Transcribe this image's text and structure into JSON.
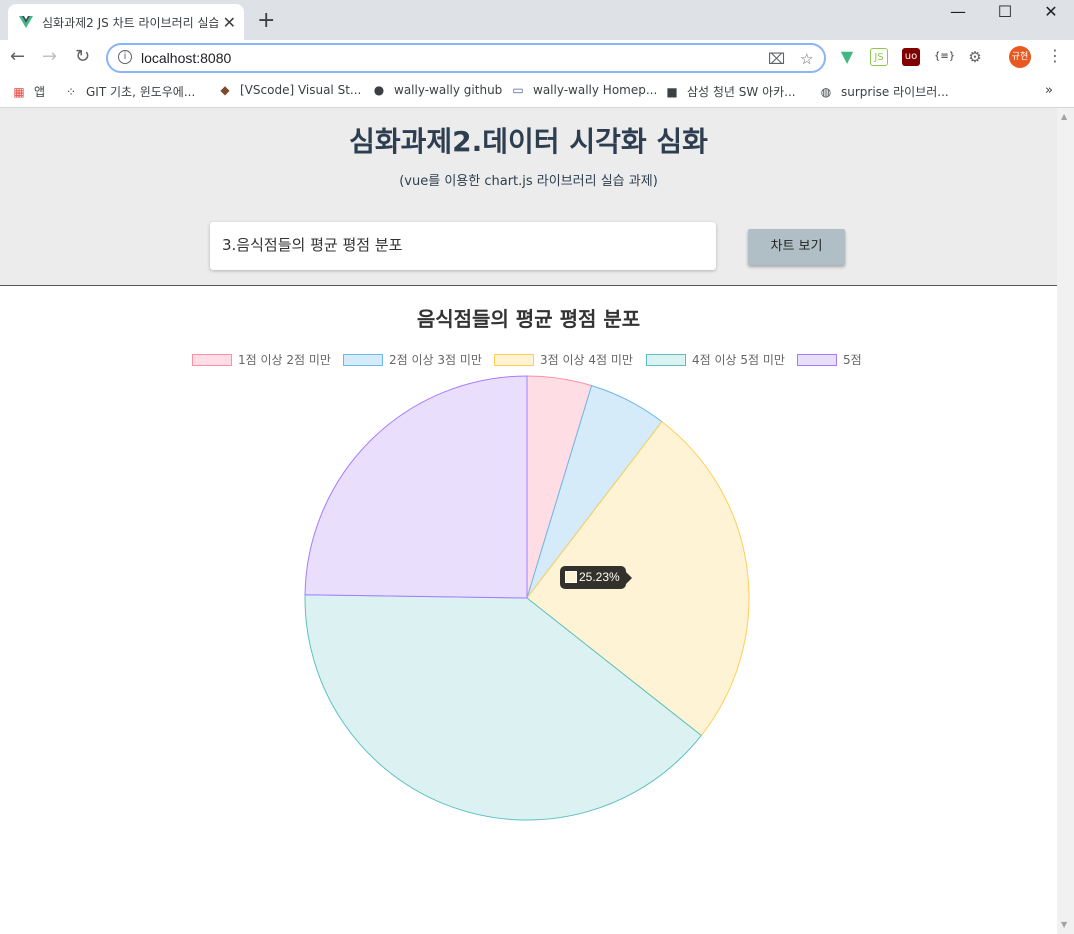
{
  "browser": {
    "tab_title": "심화과제2 JS 차트 라이브러리 실습",
    "url": "localhost:8080",
    "bookmarks": [
      "앱",
      "GIT 기초, 윈도우에...",
      "[VScode] Visual St...",
      "wally-wally github",
      "wally-wally Homep...",
      "삼성 청년 SW 아카...",
      "surprise 라이브러..."
    ],
    "profile_label": "규현",
    "icons": {
      "back": "back-arrow-icon",
      "forward": "forward-arrow-icon",
      "reload": "reload-icon",
      "apps": "apps-grid-icon",
      "vue_devtools": "vue-devtools-icon",
      "node": "nodejs-icon",
      "ublock": "ublock-icon",
      "json_viewer": "json-viewer-icon",
      "settings": "gear-icon"
    }
  },
  "header": {
    "title": "심화과제2.데이터 시각화 심화",
    "subtitle": "(vue를 이용한 chart.js 라이브러리 실습 과제)",
    "select_value": "3.음식점들의 평균 평점 분포",
    "button_label": "차트 보기"
  },
  "chart_data": {
    "type": "pie",
    "title": "음식점들의 평균 평점 분포",
    "legend_position": "top",
    "categories": [
      "1점 이상 2점 미만",
      "2점 이상 3점 미만",
      "3점 이상 4점 미만",
      "4점 이상 5점 미만",
      "5점"
    ],
    "values": [
      4.7,
      5.7,
      25.23,
      39.6,
      24.77
    ],
    "fill_colors": [
      "#ffdde4",
      "#d6ebf9",
      "#fff3d6",
      "#dcf2f2",
      "#eadefd"
    ],
    "border_colors": [
      "#ff8fa6",
      "#6cb8ea",
      "#ffce56",
      "#5cc0c0",
      "#a47dff"
    ],
    "tooltip": {
      "category_index": 2,
      "text": "25.23%"
    }
  }
}
